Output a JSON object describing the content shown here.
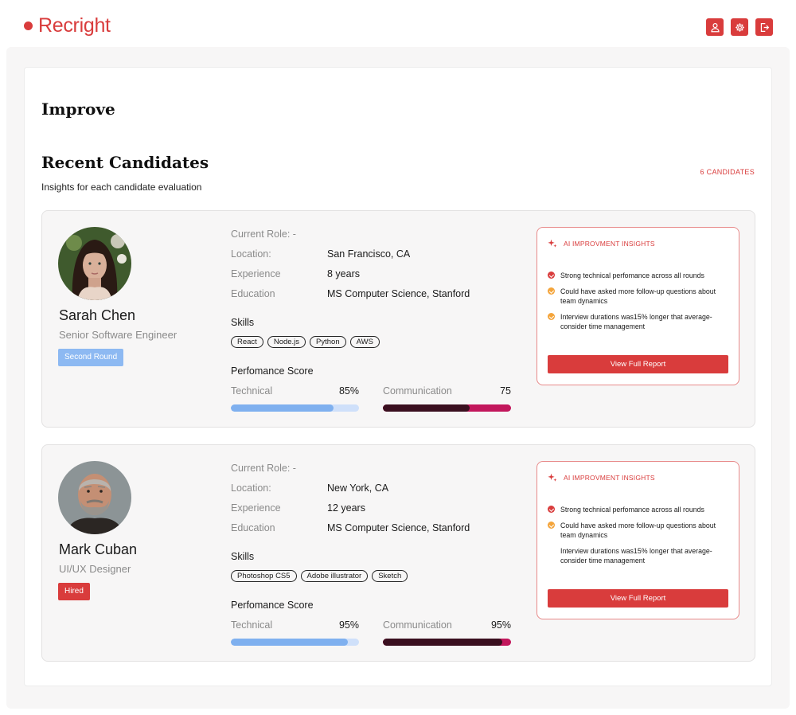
{
  "app": {
    "logo_text": "Recright",
    "brand_color": "#d93c3c"
  },
  "header": {
    "actions": [
      {
        "icon": "user-icon"
      },
      {
        "icon": "gear-icon"
      },
      {
        "icon": "logout-icon"
      }
    ]
  },
  "page": {
    "title": "Improve",
    "section_title": "Recent Candidates",
    "section_subtitle": "Insights for each candidate evaluation",
    "candidate_count": "6 CANDIDATES"
  },
  "labels": {
    "current_role": "Current Role: -",
    "location": "Location:",
    "experience": "Experience",
    "education": "Education",
    "skills": "Skills",
    "performance": "Perfomance Score",
    "technical": "Technical",
    "communication": "Communication",
    "insights_title": "AI IMPROVMENT INSIGHTS",
    "view_report": "View Full Report"
  },
  "candidates": [
    {
      "name": "Sarah Chen",
      "role": "Senior Software Engineer",
      "stage": "Second Round",
      "stage_color": "#8db9f2",
      "location": "San Francisco, CA",
      "experience": "8 years",
      "education": "MS Computer Science, Stanford",
      "skills": [
        "React",
        "Node.js",
        "Python",
        "AWS"
      ],
      "technical_score": "85%",
      "technical_fill": 0.8,
      "communication_score": "75",
      "communication_fill": 0.68,
      "insights": [
        {
          "status": "red",
          "text": "Strong technical perfomance across all rounds"
        },
        {
          "status": "orange",
          "text": "Could have asked more follow-up questions about team dynamics"
        },
        {
          "status": "orange",
          "text": "Interview durations was15% longer that average- consider time management"
        }
      ]
    },
    {
      "name": "Mark Cuban",
      "role": "UI/UX Designer",
      "stage": "Hired",
      "stage_color": "#d93c3c",
      "location": "New York, CA",
      "experience": "12 years",
      "education": "MS Computer Science, Stanford",
      "skills": [
        "Photoshop CS5",
        "Adobe illustrator",
        "Sketch"
      ],
      "technical_score": "95%",
      "technical_fill": 0.91,
      "communication_score": "95%",
      "communication_fill": 0.93,
      "insights": [
        {
          "status": "red",
          "text": "Strong technical perfomance across all rounds"
        },
        {
          "status": "orange",
          "text": "Could have asked more follow-up questions about team dynamics"
        },
        {
          "status": "none",
          "text": "Interview durations was15% longer that average- consider time management"
        }
      ]
    }
  ]
}
